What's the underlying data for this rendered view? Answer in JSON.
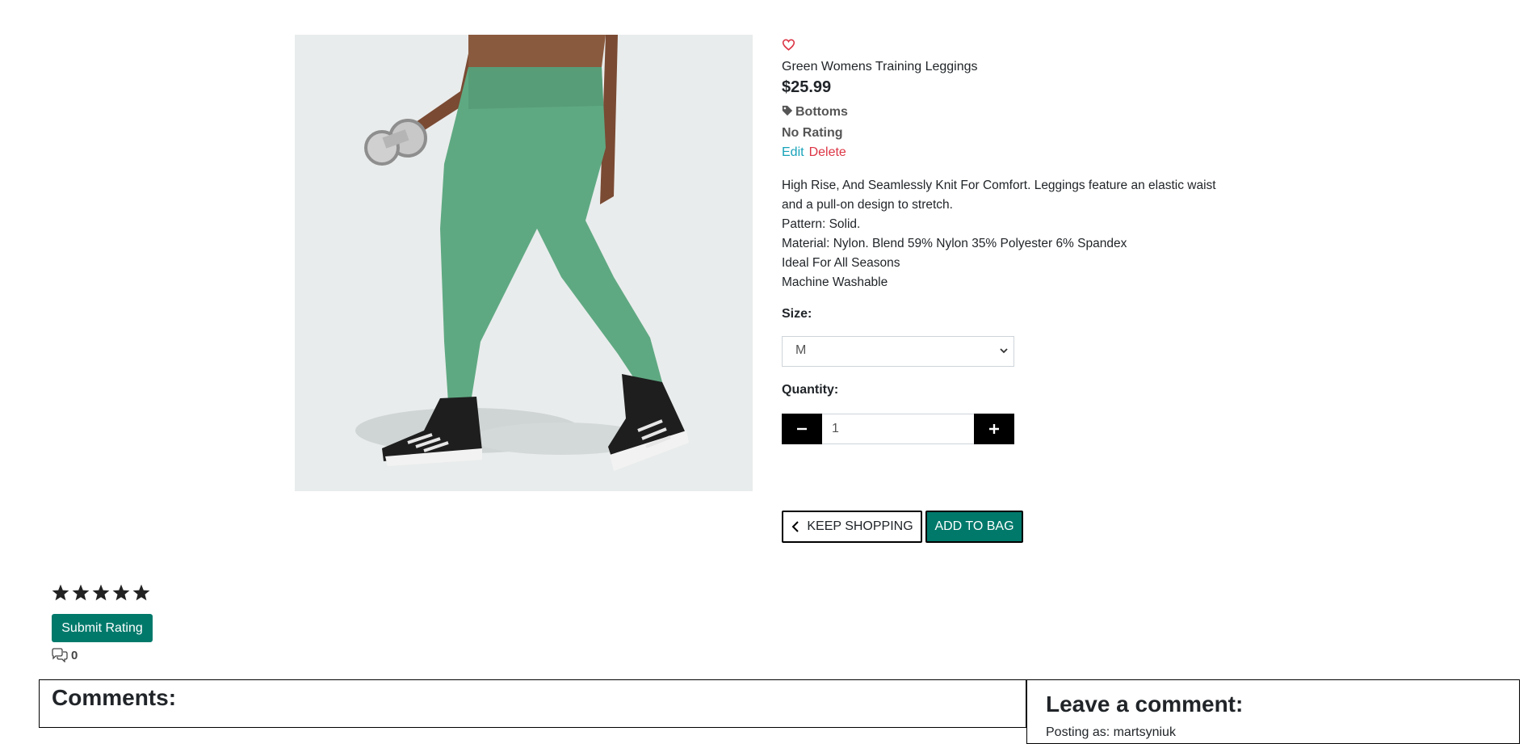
{
  "product": {
    "name": "Green Womens Training Leggings",
    "price": "$25.99",
    "category": "Bottoms",
    "rating_text": "No Rating",
    "image_alt": "Green Womens Training Leggings",
    "colors": {
      "leggings": "#5fa982",
      "background": "#e9ecec"
    }
  },
  "admin": {
    "edit_label": "Edit",
    "delete_label": "Delete"
  },
  "description_lines": [
    "High Rise, And Seamlessly Knit For Comfort. Leggings feature an elastic waist",
    "and a pull-on design to stretch.",
    "Pattern: Solid.",
    "Material: Nylon. Blend 59% Nylon 35% Polyester 6% Spandex",
    "Ideal For All Seasons",
    "Machine Washable"
  ],
  "size": {
    "label": "Size:",
    "selected": "M"
  },
  "quantity": {
    "label": "Quantity:",
    "value": "1"
  },
  "buttons": {
    "keep_shopping": "KEEP SHOPPING",
    "add_to_bag": "ADD TO BAG"
  },
  "rating": {
    "stars": 5,
    "submit_label": "Submit Rating",
    "comment_count": "0"
  },
  "comments": {
    "title": "Comments:",
    "leave_title": "Leave a comment:",
    "posting_as": "Posting as: martsyniuk"
  },
  "colors": {
    "accent": "#00796b",
    "favorite": "#dc3545",
    "edit": "#17a2b8",
    "delete": "#dc3545"
  }
}
